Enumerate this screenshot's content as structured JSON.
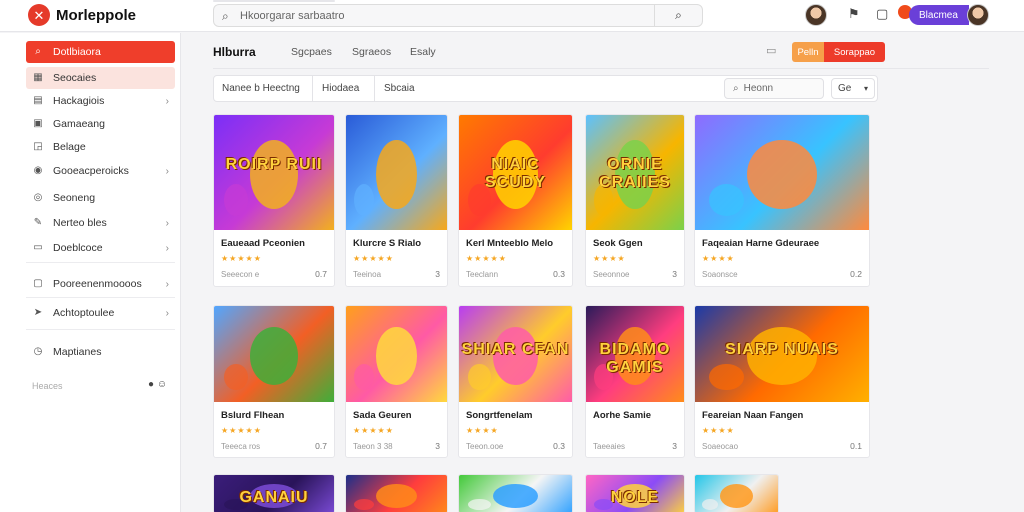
{
  "app": {
    "brand": "Morleppole",
    "logo_glyph": "✕",
    "search_placeholder": "Hkoorgarar sarbaatro"
  },
  "topbar": {
    "profile_label": "Blacmea",
    "icons": [
      "flag-icon",
      "bell-icon"
    ]
  },
  "sidebar": {
    "items": [
      {
        "label": "Dotlbiaora",
        "icon": "search-icon",
        "glyph": "⌕",
        "state": "active",
        "chevron": false
      },
      {
        "label": "Seocaies",
        "icon": "grid-icon",
        "glyph": "▦",
        "state": "soft",
        "chevron": false
      },
      {
        "label": "Hackagiois",
        "icon": "doc-icon",
        "glyph": "▤",
        "state": "",
        "chevron": true
      },
      {
        "label": "Gamaeang",
        "icon": "box-icon",
        "glyph": "▣",
        "state": "",
        "chevron": false
      },
      {
        "label": "Belage",
        "icon": "square-icon",
        "glyph": "◲",
        "state": "",
        "chevron": false
      },
      {
        "label": "Gooeacperoicks",
        "icon": "gamepad-icon",
        "glyph": "◉",
        "state": "",
        "chevron": true
      },
      {
        "label": "Seoneng",
        "icon": "circle-icon",
        "glyph": "◎",
        "state": "",
        "chevron": false
      },
      {
        "label": "Nerteo bles",
        "icon": "pen-icon",
        "glyph": "✎",
        "state": "",
        "chevron": true
      },
      {
        "label": "Doeblcoce",
        "icon": "folder-icon",
        "glyph": "▭",
        "state": "",
        "chevron": true
      },
      {
        "label": "Pooreenenmoooos",
        "icon": "monitor-icon",
        "glyph": "▢",
        "state": "",
        "chevron": true
      },
      {
        "label": "Achtoptoulee",
        "icon": "send-icon",
        "glyph": "➤",
        "state": "",
        "chevron": true
      },
      {
        "label": "Maptianes",
        "icon": "clock-icon",
        "glyph": "◷",
        "state": "",
        "chevron": false
      }
    ],
    "footer": "Heaces",
    "footer_icons": "● ☺"
  },
  "main": {
    "title": "Hlburra",
    "tabs": [
      "Sgcpaes",
      "Sgraeos",
      "Esaly"
    ],
    "btn_orange": "Pelln",
    "btn_red": "Sorappao",
    "header_icon": "▭",
    "filters": [
      "Nanee b Heectng",
      "Hiodaea",
      "Sbcaia"
    ],
    "filter_search": "Heonn",
    "filter_sort": "Ge"
  },
  "cards": [
    {
      "title": "Eaueaad Pceonien",
      "stars": "★★★★★",
      "meta": "Seeecon e",
      "count": "0.7",
      "art": "ROIRP RUII",
      "c1": "#7b2ff7",
      "c2": "#f2b01e",
      "c3": "#c63ad6"
    },
    {
      "title": "Klurcre S Rialo",
      "stars": "★★★★★",
      "meta": "Teeinoa",
      "count": "3",
      "art": "",
      "c1": "#2a5bd7",
      "c2": "#f7a81b",
      "c3": "#5fb0ff"
    },
    {
      "title": "Kerl Mnteeblo Melo",
      "stars": "★★★★★",
      "meta": "Teeclann",
      "count": "0.3",
      "art": "NIAIC SCUDY",
      "c1": "#ff7a00",
      "c2": "#ffd400",
      "c3": "#ff3c2e"
    },
    {
      "title": "Seok Ggen",
      "stars": "★★★★",
      "meta": "Seeonnoe",
      "count": "3",
      "art": "ORNIE CRAIIES",
      "c1": "#5cc1ff",
      "c2": "#7bd14a",
      "c3": "#f7b500"
    },
    {
      "title": "Faqeaian Harne Gdeuraee",
      "stars": "★★★★",
      "meta": "Soaonsce",
      "count": "0.2",
      "art": "",
      "c1": "#8e6bff",
      "c2": "#ff8a3d",
      "c3": "#38c3ff"
    },
    {
      "title": "Bslurd Flhean",
      "stars": "★★★★★",
      "meta": "Teeeca ros",
      "count": "0.7",
      "art": "",
      "c1": "#52a6ff",
      "c2": "#3fae3a",
      "c3": "#f25f25"
    },
    {
      "title": "Sada Geuren",
      "stars": "★★★★★",
      "meta": "Taeon 3 38",
      "count": "3",
      "art": "",
      "c1": "#ff9f1c",
      "c2": "#ffd93d",
      "c3": "#ff5aa5"
    },
    {
      "title": "Songrtfenelam",
      "stars": "★★★★",
      "meta": "Teeon.ooe",
      "count": "0.3",
      "art": "SHIAR CFAN",
      "c1": "#b83df2",
      "c2": "#ff5ca8",
      "c3": "#ffcc2b"
    },
    {
      "title": "Aorhe Samie",
      "stars": "",
      "meta": "Taeeaies",
      "count": "3",
      "art": "BIDAMO GAMIS",
      "c1": "#2b1b5a",
      "c2": "#ff8c1a",
      "c3": "#ff3d7f"
    },
    {
      "title": "Feareian Naan Fangen",
      "stars": "★★★★",
      "meta": "Soaeocao",
      "count": "0.1",
      "art": "SIARP NUAIS",
      "c1": "#1b3aa8",
      "c2": "#ffb000",
      "c3": "#ff6a00"
    },
    {
      "title": "",
      "stars": "",
      "meta": "",
      "count": "",
      "art": "GANAIU",
      "c1": "#3a1d7a",
      "c2": "#7b4bd6",
      "c3": "#2a145a"
    },
    {
      "title": "",
      "stars": "",
      "meta": "",
      "count": "",
      "art": "",
      "c1": "#1c2f8a",
      "c2": "#ff8a1a",
      "c3": "#ff3d3d"
    },
    {
      "title": "",
      "stars": "",
      "meta": "",
      "count": "",
      "art": "",
      "c1": "#43c93a",
      "c2": "#2ea0ff",
      "c3": "#f5f5f5"
    },
    {
      "title": "",
      "stars": "",
      "meta": "",
      "count": "",
      "art": "NOLE",
      "c1": "#ff66c4",
      "c2": "#ffd23d",
      "c3": "#8b4cf7"
    },
    {
      "title": "",
      "stars": "",
      "meta": "",
      "count": "",
      "art": "",
      "c1": "#24c6e8",
      "c2": "#ff9a1f",
      "c3": "#f0f0f0"
    },
    {
      "title": "",
      "stars": "",
      "meta": "",
      "count": "",
      "art": "",
      "c1": "#8f52ff",
      "c2": "#ffe14a",
      "c3": "#ff8c00"
    }
  ],
  "colors": {
    "accent": "#ef3e2b",
    "accent_soft": "#fbe3de",
    "orange": "#f6a04a",
    "purple": "#6a3fd8",
    "star": "#f5a623"
  }
}
